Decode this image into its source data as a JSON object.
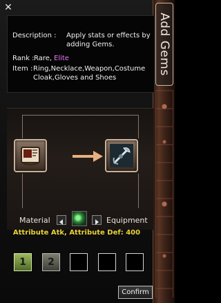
{
  "side_tab": {
    "label": "Add Gems"
  },
  "window": {
    "close_glyph": "✕"
  },
  "description": {
    "desc_label": "Description :",
    "desc_line1": "Apply stats or effects by",
    "desc_line2": "adding Gems.",
    "rank_label": "Rank :",
    "rank_rare": "Rare,",
    "rank_elite": "Elite",
    "item_label": "Item :",
    "item_line1": "Ring,Necklace,Weapon,Costume",
    "item_line2": "Cloak,Gloves and Shoes"
  },
  "combine": {
    "material_label": "Material",
    "equipment_label": "Equipment",
    "material_icon": "scroll-icon",
    "equipment_icon": "weapon-icon",
    "arrow_icon": "right-arrow-icon"
  },
  "attribute": {
    "text": "Attribute Atk, Attribute Def: 400"
  },
  "gem_slots": [
    {
      "label": "1",
      "state": "active"
    },
    {
      "label": "2",
      "state": "active"
    },
    {
      "label": "",
      "state": "empty"
    },
    {
      "label": "",
      "state": "empty"
    },
    {
      "label": "",
      "state": "empty"
    }
  ],
  "buttons": {
    "confirm": "Confirm"
  },
  "colors": {
    "elite": "#e879f0",
    "attribute": "#e9d23a",
    "arrow": "#e7b082"
  }
}
